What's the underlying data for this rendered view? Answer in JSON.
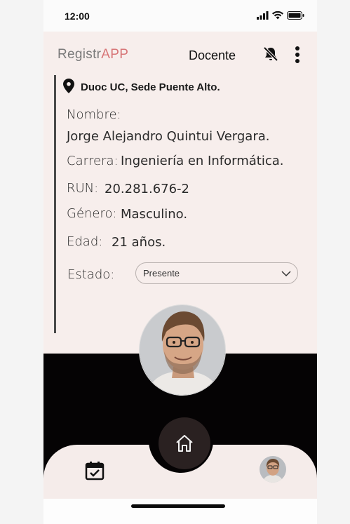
{
  "status_bar": {
    "time": "12:00"
  },
  "header": {
    "logo_part1": "Registr",
    "logo_part2": "APP",
    "role": "Docente"
  },
  "location": "Duoc UC, Sede Puente Alto.",
  "profile": {
    "name_label": "Nombre:",
    "name_value": "Jorge Alejandro Quintui Vergara.",
    "career_label": "Carrera:",
    "career_value": "Ingeniería en Informática.",
    "run_label": "RUN:",
    "run_value": "20.281.676-2",
    "gender_label": "Género:",
    "gender_value": "Masculino.",
    "age_label": "Edad:",
    "age_value": "21 años.",
    "status_label": "Estado:",
    "status_value": "Presente"
  },
  "icons": {
    "notifications": "bell-off-icon",
    "menu": "more-vertical-icon",
    "location": "map-pin-icon",
    "home": "home-icon",
    "calendar": "calendar-check-icon"
  },
  "colors": {
    "accent": "#d77577",
    "background": "#f7eeec",
    "dark": "#050304"
  }
}
